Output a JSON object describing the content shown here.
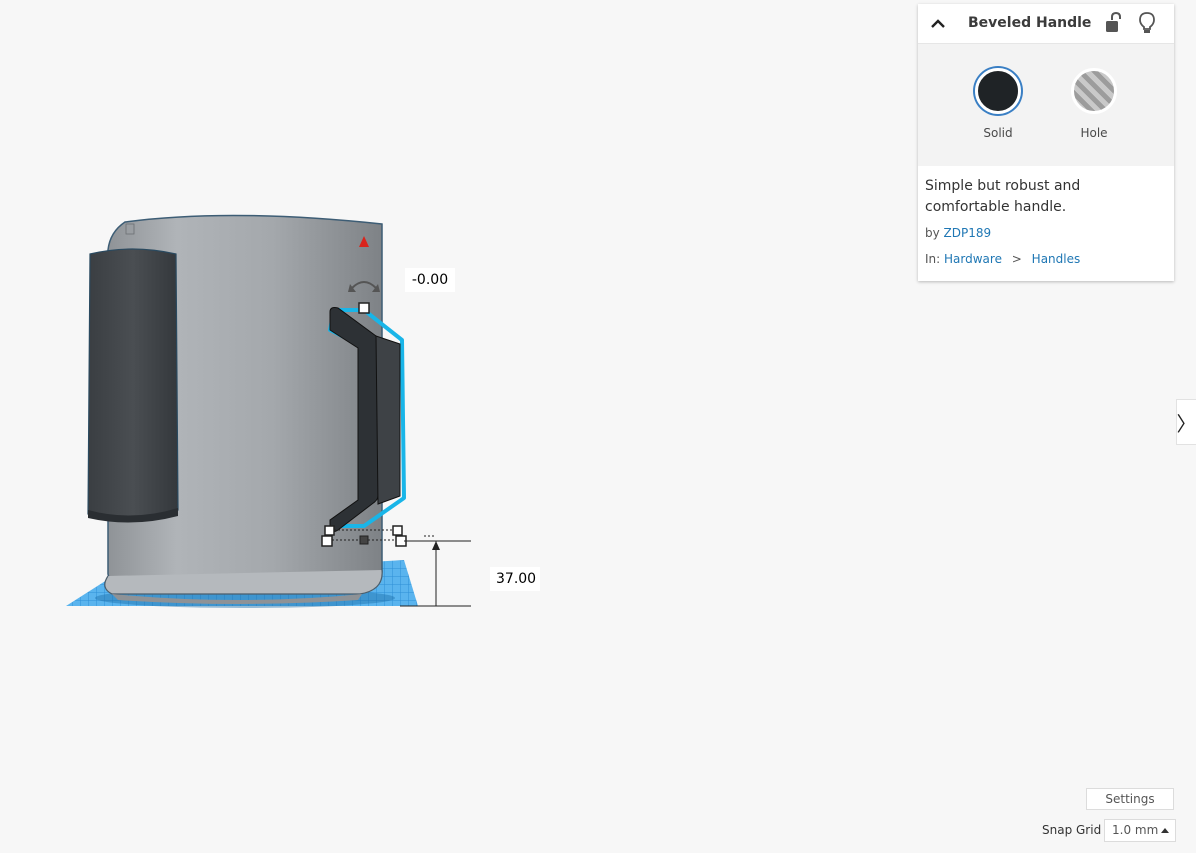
{
  "viewport": {
    "rotation_value": "-0.00",
    "height_value": "37.00"
  },
  "inspector": {
    "title": "Beveled Handle",
    "materials": [
      {
        "label": "Solid",
        "selected": true,
        "color": "#1f2326"
      },
      {
        "label": "Hole",
        "selected": false
      }
    ],
    "description": "Simple but robust and comfortable handle.",
    "author_prefix": "by",
    "author": "ZDP189",
    "category_prefix": "In:",
    "category": "Hardware",
    "subcategory": "Handles",
    "breadcrumb_separator": ">"
  },
  "side_toggle": {
    "glyph": "〉"
  },
  "footer": {
    "settings_label": "Settings",
    "snap_grid_label": "Snap Grid",
    "snap_grid_value": "1.0 mm"
  },
  "colors": {
    "selection_outline": "#19b5e8",
    "workplane_grid": "#3aa6e8",
    "mug_body": "#a8acb0",
    "handle": "#2d3135",
    "link": "#1f77b4"
  }
}
